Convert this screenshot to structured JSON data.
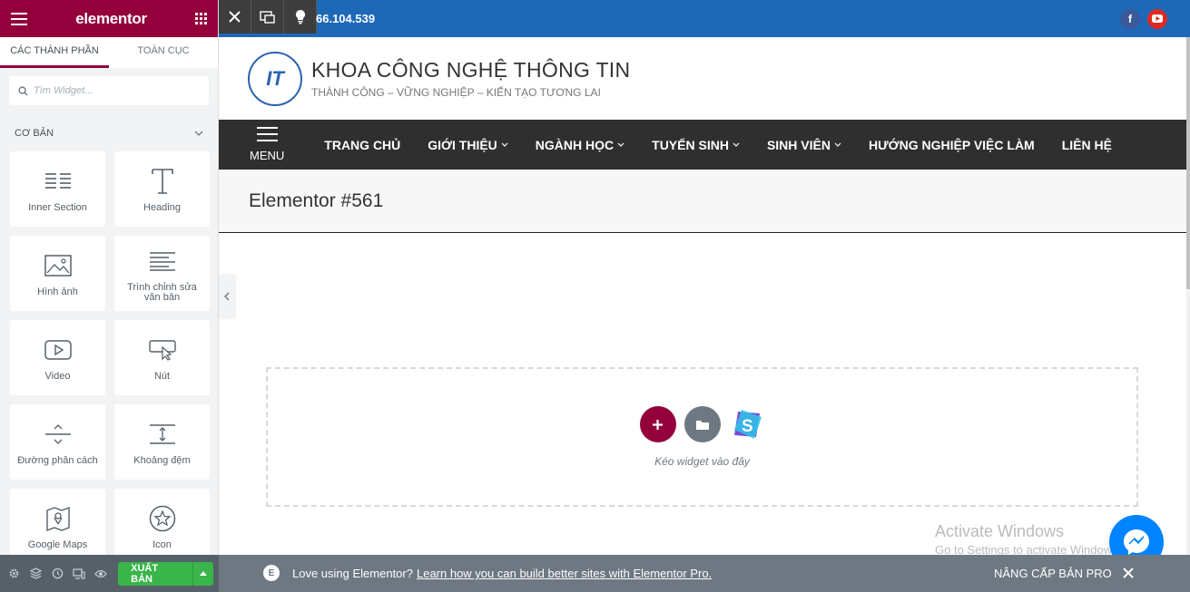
{
  "panel": {
    "brand": "elementor",
    "tabs": [
      "CÁC THÀNH PHẦN",
      "TOÀN CỤC"
    ],
    "search_placeholder": "Tìm Widget...",
    "category": "CƠ BẢN",
    "widgets": [
      {
        "label": "Inner Section",
        "icon": "inner-section-icon"
      },
      {
        "label": "Heading",
        "icon": "heading-icon"
      },
      {
        "label": "Hình ảnh",
        "icon": "image-icon"
      },
      {
        "label": "Trình chỉnh sửa văn bản",
        "icon": "text-editor-icon"
      },
      {
        "label": "Video",
        "icon": "video-icon"
      },
      {
        "label": "Nút",
        "icon": "button-icon"
      },
      {
        "label": "Đường phân cách",
        "icon": "divider-icon"
      },
      {
        "label": "Khoảng đệm",
        "icon": "spacer-icon"
      },
      {
        "label": "Google Maps",
        "icon": "google-maps-icon"
      },
      {
        "label": "Icon",
        "icon": "star-icon"
      }
    ],
    "publish_label": "XUẤT BẢN"
  },
  "site": {
    "ip_text": "66.104.539",
    "title": "KHOA CÔNG NGHỆ THÔNG TIN",
    "tagline": "THÀNH CÔNG – VỮNG NGHIỆP – KIẾN TẠO TƯƠNG LAI",
    "logo_text": "IT",
    "menu_label": "MENU",
    "nav": [
      {
        "label": "TRANG CHỦ",
        "dropdown": false
      },
      {
        "label": "GIỚI THIỆU",
        "dropdown": true
      },
      {
        "label": "NGÀNH HỌC",
        "dropdown": true
      },
      {
        "label": "TUYỂN SINH",
        "dropdown": true
      },
      {
        "label": "SINH VIÊN",
        "dropdown": true
      },
      {
        "label": "HƯỚNG NGHIỆP VIỆC LÀM",
        "dropdown": false
      },
      {
        "label": "LIÊN HỆ",
        "dropdown": false
      }
    ],
    "page_title": "Elementor #561",
    "dropzone_text": "Kéo widget vào đây"
  },
  "overlay": {
    "activate_title": "Activate Windows",
    "activate_sub": "Go to Settings to activate Windows."
  },
  "notice": {
    "text": "Love using Elementor?",
    "link": "Learn how you can build better sites with Elementor Pro.",
    "upgrade": "NÂNG CẤP BẢN PRO"
  },
  "colors": {
    "brand": "#93003c",
    "topbar": "#1e68b8",
    "nav": "#2f2f2f",
    "publish": "#39b54a"
  }
}
